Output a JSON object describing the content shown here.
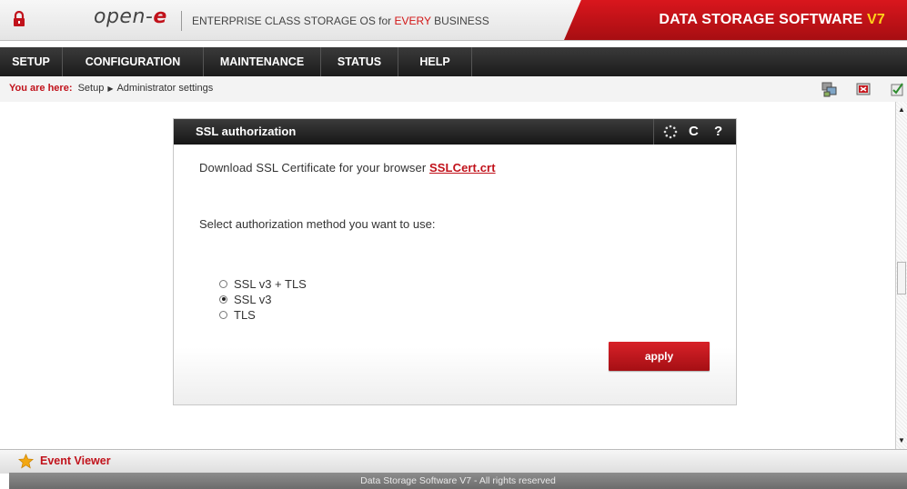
{
  "header": {
    "logo_text": "open-",
    "logo_accent": "e",
    "tagline_prefix": "ENTERPRISE CLASS STORAGE OS for ",
    "tagline_highlight": "EVERY",
    "tagline_suffix": " BUSINESS",
    "brand_title": "DATA STORAGE SOFTWARE ",
    "brand_version": "V7"
  },
  "nav": {
    "items": [
      "SETUP",
      "CONFIGURATION",
      "MAINTENANCE",
      "STATUS",
      "HELP"
    ]
  },
  "breadcrumb": {
    "label": "You are here:",
    "path": [
      "Setup",
      "Administrator settings"
    ]
  },
  "panel": {
    "title": "SSL authorization",
    "download_text": "Download SSL Certificate for your browser ",
    "download_link": "SSLCert.crt",
    "select_text": "Select authorization method you want to use:",
    "options": [
      {
        "label": "SSL v3 + TLS",
        "selected": false
      },
      {
        "label": "SSL v3",
        "selected": true
      },
      {
        "label": "TLS",
        "selected": false
      }
    ],
    "apply_label": "apply",
    "tool_refresh": "C",
    "tool_help": "?"
  },
  "footer": {
    "event_viewer": "Event Viewer",
    "copyright": "Data Storage Software V7 - All rights reserved"
  },
  "colors": {
    "accent": "#c1121b",
    "nav_bg": "#1b1b1b",
    "brand_version": "#ffd21a"
  },
  "icons": {
    "lock": "lock-icon",
    "star": "star-icon",
    "spinner": "spinner-icon"
  }
}
